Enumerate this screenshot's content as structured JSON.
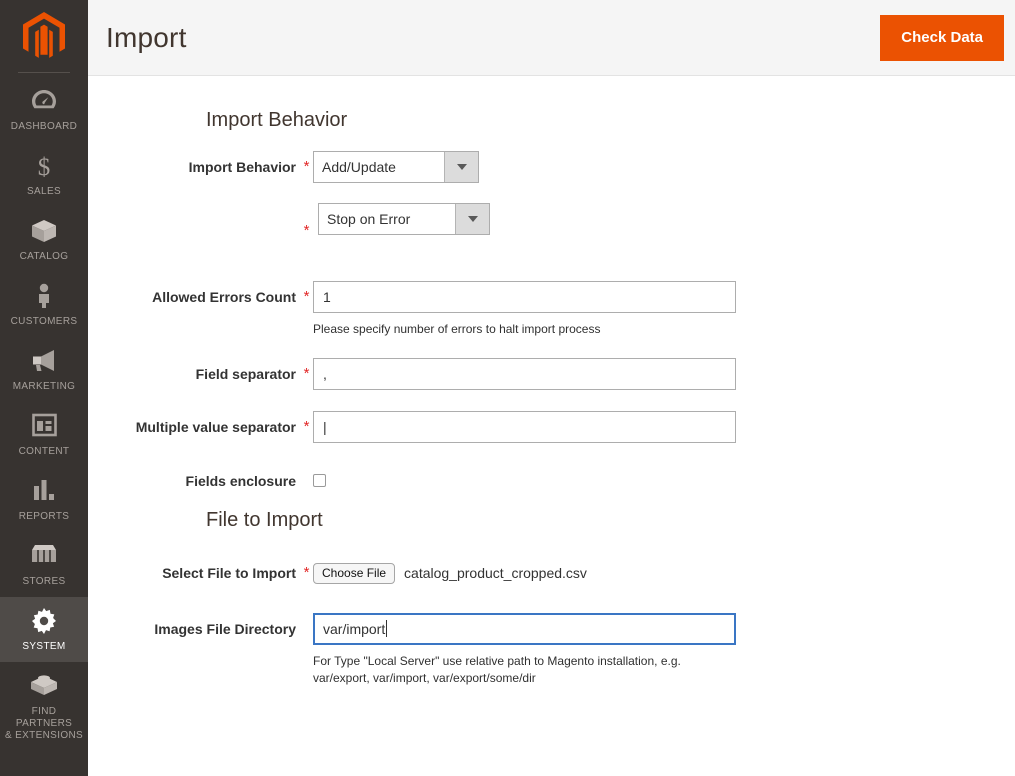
{
  "sidebar": {
    "logo": "magento-logo",
    "items": [
      {
        "id": "dashboard",
        "label": "DASHBOARD",
        "icon": "gauge-icon",
        "active": false
      },
      {
        "id": "sales",
        "label": "SALES",
        "icon": "dollar-icon",
        "active": false
      },
      {
        "id": "catalog",
        "label": "CATALOG",
        "icon": "box-icon",
        "active": false
      },
      {
        "id": "customers",
        "label": "CUSTOMERS",
        "icon": "person-icon",
        "active": false
      },
      {
        "id": "marketing",
        "label": "MARKETING",
        "icon": "megaphone-icon",
        "active": false
      },
      {
        "id": "content",
        "label": "CONTENT",
        "icon": "layout-icon",
        "active": false
      },
      {
        "id": "reports",
        "label": "REPORTS",
        "icon": "bar-chart-icon",
        "active": false
      },
      {
        "id": "stores",
        "label": "STORES",
        "icon": "storefront-icon",
        "active": false
      },
      {
        "id": "system",
        "label": "SYSTEM",
        "icon": "gear-icon",
        "active": true
      },
      {
        "id": "partners",
        "label": "FIND PARTNERS\n& EXTENSIONS",
        "icon": "extension-icon",
        "active": false
      }
    ]
  },
  "header": {
    "title": "Import",
    "check_data_label": "Check Data"
  },
  "sections": {
    "import_behavior": {
      "title": "Import Behavior",
      "fields": {
        "import_behavior": {
          "label": "Import Behavior",
          "required_marker": "*",
          "value": "Add/Update"
        },
        "error_handling": {
          "label": "",
          "required_marker": "*",
          "value": "Stop on Error"
        },
        "allowed_errors_count": {
          "label": "Allowed Errors Count",
          "required_marker": "*",
          "value": "1",
          "hint": "Please specify number of errors to halt import process"
        },
        "field_separator": {
          "label": "Field separator",
          "required_marker": "*",
          "value": ","
        },
        "multiple_value_separator": {
          "label": "Multiple value separator",
          "required_marker": "*",
          "value": "|"
        },
        "fields_enclosure": {
          "label": "Fields enclosure",
          "checked": false
        }
      }
    },
    "file_to_import": {
      "title": "File to Import",
      "fields": {
        "select_file": {
          "label": "Select File to Import",
          "required_marker": "*",
          "button_label": "Choose File",
          "filename": "catalog_product_cropped.csv"
        },
        "images_file_directory": {
          "label": "Images File Directory",
          "value": "var/import",
          "hint": "For Type \"Local Server\" use relative path to Magento installation, e.g. var/export, var/import, var/export/some/dir"
        }
      }
    }
  },
  "colors": {
    "brand_orange": "#eb5202",
    "sidebar_bg": "#373330",
    "sidebar_active_bg": "#4f4b48",
    "required_red": "#e22626",
    "focus_blue": "#3a76c4"
  }
}
